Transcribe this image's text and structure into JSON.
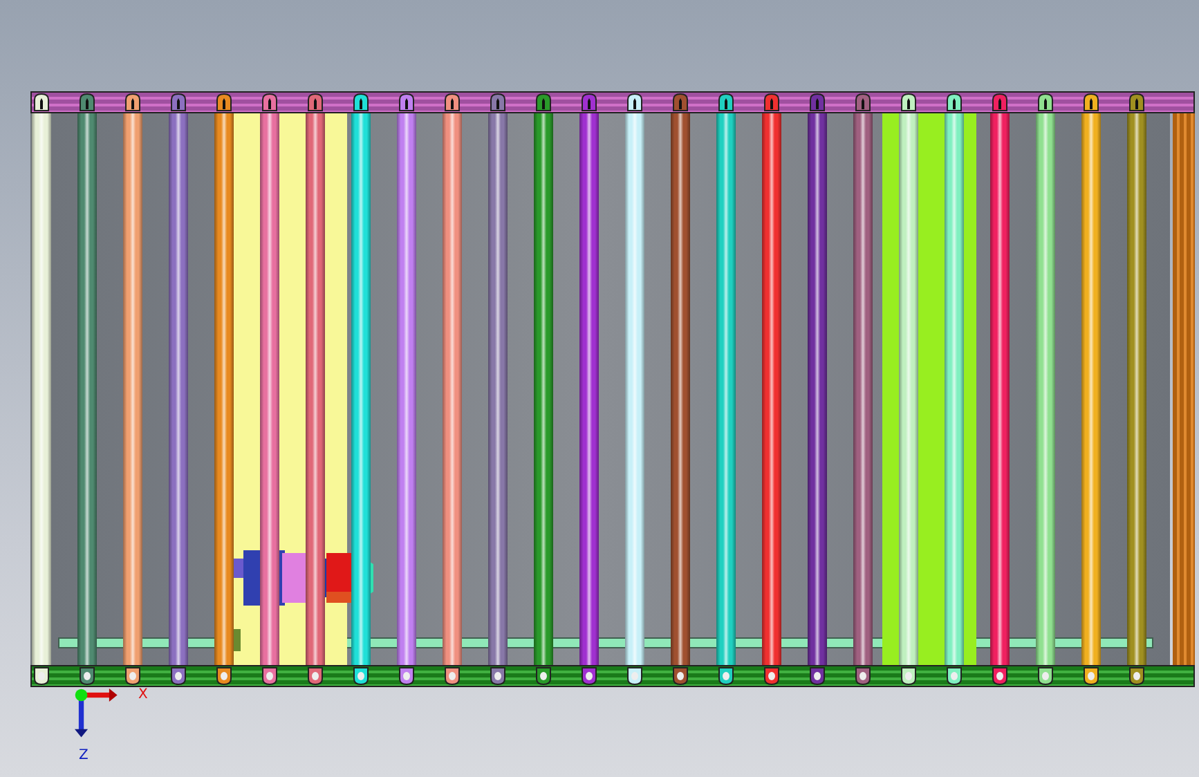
{
  "rollers": [
    {
      "color": "#e8f0d8"
    },
    {
      "color": "#4f8a70"
    },
    {
      "color": "#f0a070"
    },
    {
      "color": "#8c70c0"
    },
    {
      "color": "#e88a20"
    },
    {
      "color": "#e870a0"
    },
    {
      "color": "#e06878"
    },
    {
      "color": "#20e0d8"
    },
    {
      "color": "#c080f0"
    },
    {
      "color": "#f09080"
    },
    {
      "color": "#8878a8"
    },
    {
      "color": "#2a9a2a"
    },
    {
      "color": "#a030d0"
    },
    {
      "color": "#c8f0f8"
    },
    {
      "color": "#a05030"
    },
    {
      "color": "#20d0c0"
    },
    {
      "color": "#f03030"
    },
    {
      "color": "#7030a0"
    },
    {
      "color": "#a06080"
    },
    {
      "color": "#c0f0c0"
    },
    {
      "color": "#80f0c0"
    },
    {
      "color": "#f02060"
    },
    {
      "color": "#90e090"
    },
    {
      "color": "#f0b020"
    },
    {
      "color": "#a09020"
    }
  ],
  "axes": [
    {
      "label": "X"
    },
    {
      "label": "Z"
    }
  ]
}
